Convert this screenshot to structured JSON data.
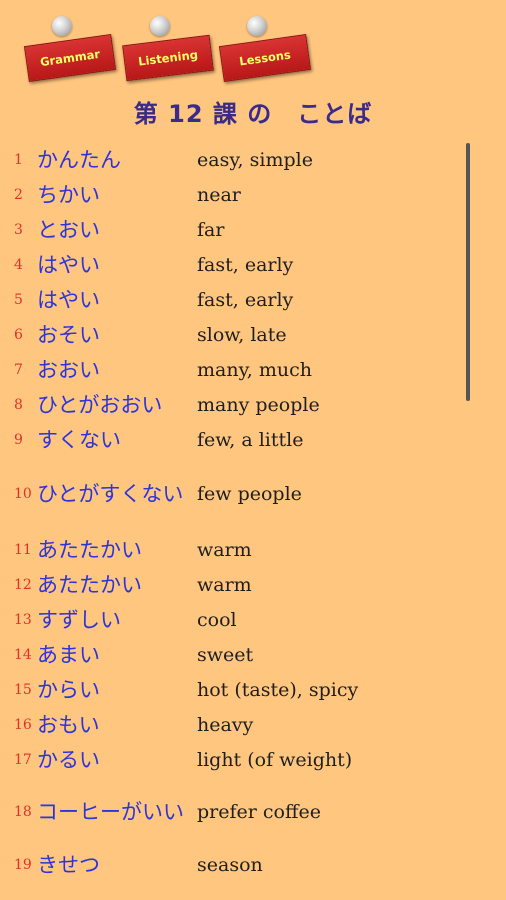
{
  "tabs": [
    {
      "label": "Grammar"
    },
    {
      "label": "Listening"
    },
    {
      "label": "Lessons"
    }
  ],
  "title": "第 12 課 の　ことば",
  "vocab": [
    {
      "num": "1",
      "jp": "かんたん",
      "en": "easy, simple"
    },
    {
      "num": "2",
      "jp": "ちかい",
      "en": "near"
    },
    {
      "num": "3",
      "jp": "とおい",
      "en": "far"
    },
    {
      "num": "4",
      "jp": "はやい",
      "en": "fast, early"
    },
    {
      "num": "5",
      "jp": "はやい",
      "en": "fast, early"
    },
    {
      "num": "6",
      "jp": "おそい",
      "en": "slow, late"
    },
    {
      "num": "7",
      "jp": "おおい",
      "en": "many, much"
    },
    {
      "num": "8",
      "jp": "ひとがおおい",
      "en": "many people"
    },
    {
      "num": "9",
      "jp": "すくない",
      "en": "few, a little"
    },
    {
      "num": "10",
      "jp": "ひとがすくない",
      "en": "few people"
    },
    {
      "num": "11",
      "jp": "あたたかい",
      "en": "warm"
    },
    {
      "num": "12",
      "jp": "あたたかい",
      "en": "warm"
    },
    {
      "num": "13",
      "jp": "すずしい",
      "en": "cool"
    },
    {
      "num": "14",
      "jp": "あまい",
      "en": "sweet"
    },
    {
      "num": "15",
      "jp": "からい",
      "en": "hot (taste), spicy"
    },
    {
      "num": "16",
      "jp": "おもい",
      "en": "heavy"
    },
    {
      "num": "17",
      "jp": "かるい",
      "en": "light (of weight)"
    },
    {
      "num": "18",
      "jp": "コーヒーがいい",
      "en": "prefer coffee"
    },
    {
      "num": "19",
      "jp": "きせつ",
      "en": "season"
    }
  ]
}
